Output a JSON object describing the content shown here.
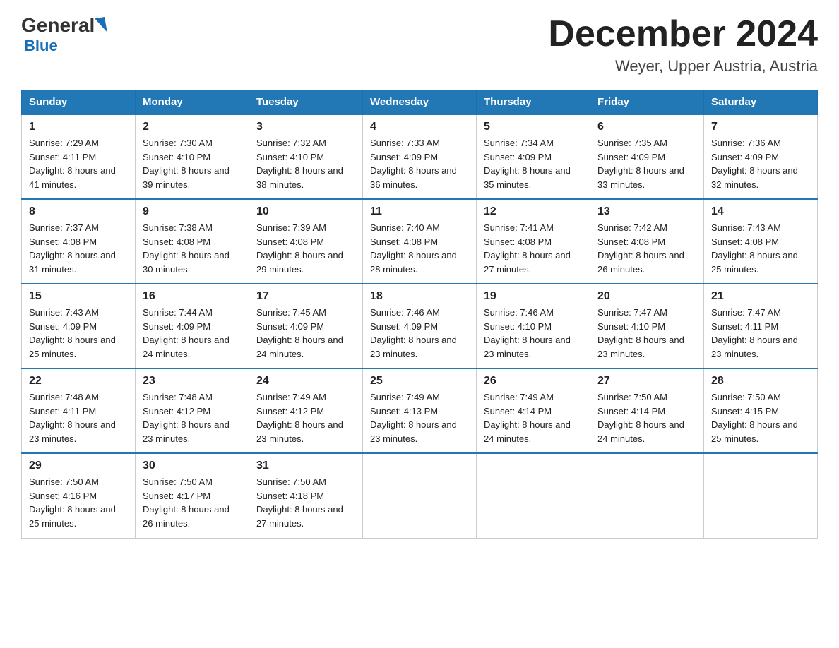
{
  "header": {
    "logo_general": "General",
    "logo_blue": "Blue",
    "month_title": "December 2024",
    "location": "Weyer, Upper Austria, Austria"
  },
  "days_of_week": [
    "Sunday",
    "Monday",
    "Tuesday",
    "Wednesday",
    "Thursday",
    "Friday",
    "Saturday"
  ],
  "weeks": [
    [
      {
        "day": "1",
        "sunrise": "7:29 AM",
        "sunset": "4:11 PM",
        "daylight": "8 hours and 41 minutes."
      },
      {
        "day": "2",
        "sunrise": "7:30 AM",
        "sunset": "4:10 PM",
        "daylight": "8 hours and 39 minutes."
      },
      {
        "day": "3",
        "sunrise": "7:32 AM",
        "sunset": "4:10 PM",
        "daylight": "8 hours and 38 minutes."
      },
      {
        "day": "4",
        "sunrise": "7:33 AM",
        "sunset": "4:09 PM",
        "daylight": "8 hours and 36 minutes."
      },
      {
        "day": "5",
        "sunrise": "7:34 AM",
        "sunset": "4:09 PM",
        "daylight": "8 hours and 35 minutes."
      },
      {
        "day": "6",
        "sunrise": "7:35 AM",
        "sunset": "4:09 PM",
        "daylight": "8 hours and 33 minutes."
      },
      {
        "day": "7",
        "sunrise": "7:36 AM",
        "sunset": "4:09 PM",
        "daylight": "8 hours and 32 minutes."
      }
    ],
    [
      {
        "day": "8",
        "sunrise": "7:37 AM",
        "sunset": "4:08 PM",
        "daylight": "8 hours and 31 minutes."
      },
      {
        "day": "9",
        "sunrise": "7:38 AM",
        "sunset": "4:08 PM",
        "daylight": "8 hours and 30 minutes."
      },
      {
        "day": "10",
        "sunrise": "7:39 AM",
        "sunset": "4:08 PM",
        "daylight": "8 hours and 29 minutes."
      },
      {
        "day": "11",
        "sunrise": "7:40 AM",
        "sunset": "4:08 PM",
        "daylight": "8 hours and 28 minutes."
      },
      {
        "day": "12",
        "sunrise": "7:41 AM",
        "sunset": "4:08 PM",
        "daylight": "8 hours and 27 minutes."
      },
      {
        "day": "13",
        "sunrise": "7:42 AM",
        "sunset": "4:08 PM",
        "daylight": "8 hours and 26 minutes."
      },
      {
        "day": "14",
        "sunrise": "7:43 AM",
        "sunset": "4:08 PM",
        "daylight": "8 hours and 25 minutes."
      }
    ],
    [
      {
        "day": "15",
        "sunrise": "7:43 AM",
        "sunset": "4:09 PM",
        "daylight": "8 hours and 25 minutes."
      },
      {
        "day": "16",
        "sunrise": "7:44 AM",
        "sunset": "4:09 PM",
        "daylight": "8 hours and 24 minutes."
      },
      {
        "day": "17",
        "sunrise": "7:45 AM",
        "sunset": "4:09 PM",
        "daylight": "8 hours and 24 minutes."
      },
      {
        "day": "18",
        "sunrise": "7:46 AM",
        "sunset": "4:09 PM",
        "daylight": "8 hours and 23 minutes."
      },
      {
        "day": "19",
        "sunrise": "7:46 AM",
        "sunset": "4:10 PM",
        "daylight": "8 hours and 23 minutes."
      },
      {
        "day": "20",
        "sunrise": "7:47 AM",
        "sunset": "4:10 PM",
        "daylight": "8 hours and 23 minutes."
      },
      {
        "day": "21",
        "sunrise": "7:47 AM",
        "sunset": "4:11 PM",
        "daylight": "8 hours and 23 minutes."
      }
    ],
    [
      {
        "day": "22",
        "sunrise": "7:48 AM",
        "sunset": "4:11 PM",
        "daylight": "8 hours and 23 minutes."
      },
      {
        "day": "23",
        "sunrise": "7:48 AM",
        "sunset": "4:12 PM",
        "daylight": "8 hours and 23 minutes."
      },
      {
        "day": "24",
        "sunrise": "7:49 AM",
        "sunset": "4:12 PM",
        "daylight": "8 hours and 23 minutes."
      },
      {
        "day": "25",
        "sunrise": "7:49 AM",
        "sunset": "4:13 PM",
        "daylight": "8 hours and 23 minutes."
      },
      {
        "day": "26",
        "sunrise": "7:49 AM",
        "sunset": "4:14 PM",
        "daylight": "8 hours and 24 minutes."
      },
      {
        "day": "27",
        "sunrise": "7:50 AM",
        "sunset": "4:14 PM",
        "daylight": "8 hours and 24 minutes."
      },
      {
        "day": "28",
        "sunrise": "7:50 AM",
        "sunset": "4:15 PM",
        "daylight": "8 hours and 25 minutes."
      }
    ],
    [
      {
        "day": "29",
        "sunrise": "7:50 AM",
        "sunset": "4:16 PM",
        "daylight": "8 hours and 25 minutes."
      },
      {
        "day": "30",
        "sunrise": "7:50 AM",
        "sunset": "4:17 PM",
        "daylight": "8 hours and 26 minutes."
      },
      {
        "day": "31",
        "sunrise": "7:50 AM",
        "sunset": "4:18 PM",
        "daylight": "8 hours and 27 minutes."
      },
      null,
      null,
      null,
      null
    ]
  ]
}
